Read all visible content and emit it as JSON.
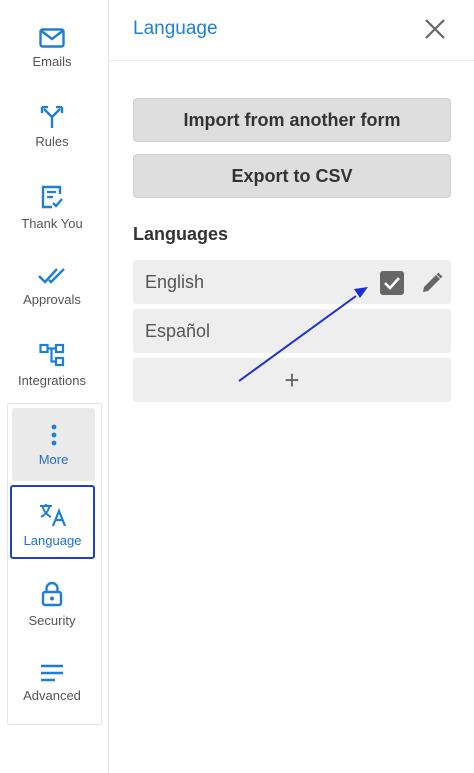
{
  "sidebar": {
    "items": [
      {
        "label": "Emails",
        "icon": "mail-icon"
      },
      {
        "label": "Rules",
        "icon": "split-arrow-icon"
      },
      {
        "label": "Thank You",
        "icon": "doc-check-icon"
      },
      {
        "label": "Approvals",
        "icon": "double-check-icon"
      },
      {
        "label": "Integrations",
        "icon": "flow-icon"
      },
      {
        "label": "More",
        "icon": "more-vertical-icon"
      },
      {
        "label": "Language",
        "icon": "translate-icon"
      },
      {
        "label": "Security",
        "icon": "lock-icon"
      },
      {
        "label": "Advanced",
        "icon": "lines-icon"
      }
    ]
  },
  "header": {
    "title": "Language"
  },
  "actions": {
    "import_label": "Import from another form",
    "export_label": "Export to CSV"
  },
  "languages": {
    "section_label": "Languages",
    "items": [
      "English",
      "Español"
    ],
    "add_label": "+"
  },
  "colors": {
    "accent": "#1d7fd8",
    "active_border": "#1e40c8",
    "arrow": "#1a2fd6"
  }
}
